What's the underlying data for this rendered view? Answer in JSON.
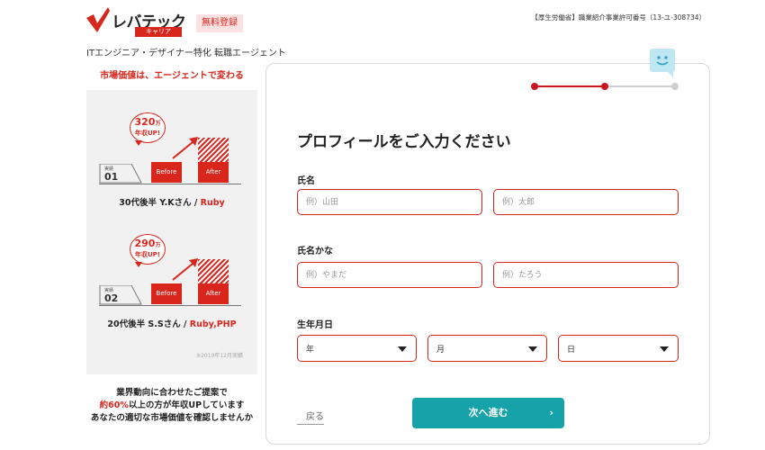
{
  "header": {
    "logo_text": "レバテック",
    "logo_sub": "キャリア",
    "badge": "無料登録",
    "license": "【厚生労働省】職業紹介事業許可番号（13-ユ-308734）",
    "tagline": "ITエンジニア・デザイナー特化 転職エージェント"
  },
  "left": {
    "catch": "市場価値は、エージェントで変わる",
    "cases": [
      {
        "amount": "320",
        "unit": "万",
        "raise_label": "年収UP!",
        "result_small": "実績",
        "result_num": "01",
        "before": "Before",
        "after": "After",
        "person": "30代後半 Y.Kさん / ",
        "skill": "Ruby"
      },
      {
        "amount": "290",
        "unit": "万",
        "raise_label": "年収UP!",
        "result_small": "実績",
        "result_num": "02",
        "before": "Before",
        "after": "After",
        "person": "20代後半 S.Sさん / ",
        "skill": "Ruby,PHP"
      }
    ],
    "footnote": "※2019年12月実績",
    "copy_line1": "業界動向に合わせたご提案で",
    "copy_line2_hl": "約60%",
    "copy_line2_rest": "以上の方が年収UPしています",
    "copy_line3": "あなたの適切な市場価値を確認しませんか"
  },
  "form": {
    "title": "プロフィールをご入力ください",
    "progress": {
      "current_step": 2,
      "total_steps": 3
    },
    "name_label": "氏名",
    "last_name_placeholder": "例）山田",
    "first_name_placeholder": "例）太郎",
    "kana_label": "氏名かな",
    "last_kana_placeholder": "例）やまだ",
    "first_kana_placeholder": "例）たろう",
    "birth_label": "生年月日",
    "year_value": "年",
    "month_value": "月",
    "day_value": "日",
    "back_label": "戻る",
    "next_label": "次へ進む",
    "next_chevron": "›"
  },
  "colors": {
    "accent": "#d9261c",
    "button": "#16a2a9",
    "panel": "#f1f1f1"
  }
}
